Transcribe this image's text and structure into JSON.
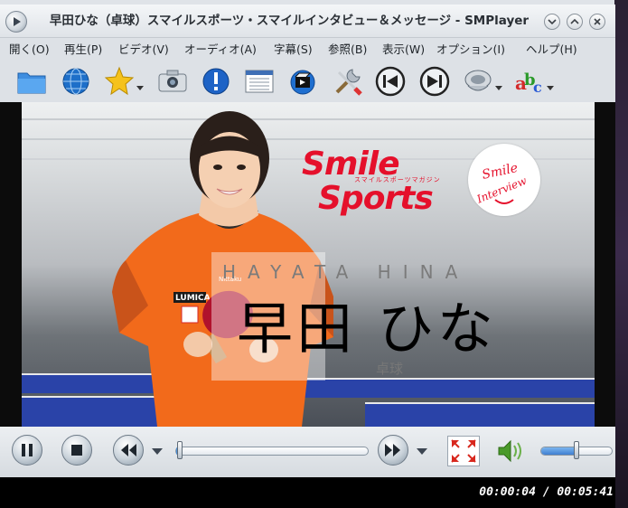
{
  "window": {
    "title": "早田ひな（卓球）スマイルスポーツ・スマイルインタビュー＆メッセージ - SMPlayer"
  },
  "menu": [
    {
      "label": "開く(O)"
    },
    {
      "label": "再生(P)"
    },
    {
      "label": "ビデオ(V)"
    },
    {
      "label": "オーディオ(A)"
    },
    {
      "label": "字幕(S)"
    },
    {
      "label": "参照(B)"
    },
    {
      "label": "表示(W)"
    },
    {
      "label": "オプション(I)"
    },
    {
      "label": "ヘルプ(H)"
    }
  ],
  "toolbar": [
    {
      "icon": "folder-icon"
    },
    {
      "icon": "globe-icon"
    },
    {
      "icon": "favorites-star-icon"
    },
    {
      "icon": "screenshot-camera-icon"
    },
    {
      "icon": "info-icon"
    },
    {
      "icon": "playlist-icon"
    },
    {
      "icon": "video-preferences-icon"
    },
    {
      "icon": "tools-icon"
    },
    {
      "icon": "previous-icon"
    },
    {
      "icon": "next-icon"
    },
    {
      "icon": "audio-icon"
    },
    {
      "icon": "subtitles-icon"
    }
  ],
  "video": {
    "logo_line1": "Smile",
    "logo_line2": "Sports",
    "logo_subtitle": "スマイルスポーツマガジン",
    "seal_line1": "Smile",
    "seal_line2": "Interview",
    "name_romaji": "HAYATA HINA",
    "name_kanji": "早田 ひな",
    "name_sport": "卓球",
    "shirt_brand": "LUMICA",
    "shirt_brand2": "Nittaku"
  },
  "playback": {
    "position_fraction": 0.012,
    "volume_fraction": 0.5,
    "time_display": "00:00:04 / 00:05:41"
  },
  "colors": {
    "accent": "#e5102b",
    "seek_fill": "#4a8fd8",
    "shirt": "#f26a1b"
  }
}
